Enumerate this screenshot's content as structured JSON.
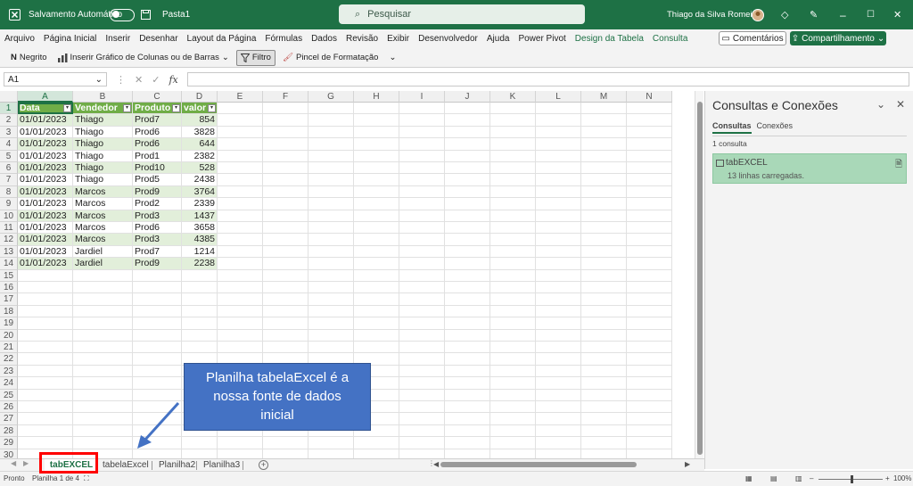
{
  "titlebar": {
    "autosave_label": "Salvamento Automático",
    "doc_name": "Pasta1",
    "search_placeholder": "Pesquisar",
    "user_name": "Thiago da Silva Romeiro",
    "accent_color": "#1e7145"
  },
  "menu": {
    "items": [
      "Arquivo",
      "Página Inicial",
      "Inserir",
      "Desenhar",
      "Layout da Página",
      "Fórmulas",
      "Dados",
      "Revisão",
      "Exibir",
      "Desenvolvedor",
      "Ajuda",
      "Power Pivot",
      "Design da Tabela",
      "Consulta"
    ],
    "comments_label": "Comentários",
    "share_label": "Compartilhamento"
  },
  "ribbon": {
    "bold_label": "Negrito",
    "chart_label": "Inserir Gráfico de Colunas ou de Barras",
    "filter_label": "Filtro",
    "format_painter_label": "Pincel de Formatação"
  },
  "formula_bar": {
    "name_box": "A1",
    "fx_label": "fx"
  },
  "sheet": {
    "columns": [
      "A",
      "B",
      "C",
      "D",
      "E",
      "F",
      "G",
      "H",
      "I",
      "J",
      "K",
      "L",
      "M",
      "N"
    ],
    "row_numbers": [
      "1",
      "2",
      "3",
      "4",
      "5",
      "6",
      "7",
      "8",
      "9",
      "10",
      "11",
      "12",
      "13",
      "14",
      "15",
      "16",
      "17",
      "18",
      "19",
      "20",
      "21",
      "22",
      "23",
      "24",
      "25",
      "26",
      "27",
      "28",
      "29",
      "30"
    ],
    "table_headers": [
      "Data",
      "Vendedor",
      "Produto",
      "valor"
    ],
    "table_rows": [
      [
        "01/01/2023",
        "Thiago",
        "Prod7",
        "854"
      ],
      [
        "01/01/2023",
        "Thiago",
        "Prod6",
        "3828"
      ],
      [
        "01/01/2023",
        "Thiago",
        "Prod6",
        "644"
      ],
      [
        "01/01/2023",
        "Thiago",
        "Prod1",
        "2382"
      ],
      [
        "01/01/2023",
        "Thiago",
        "Prod10",
        "528"
      ],
      [
        "01/01/2023",
        "Thiago",
        "Prod5",
        "2438"
      ],
      [
        "01/01/2023",
        "Marcos",
        "Prod9",
        "3764"
      ],
      [
        "01/01/2023",
        "Marcos",
        "Prod2",
        "2339"
      ],
      [
        "01/01/2023",
        "Marcos",
        "Prod3",
        "1437"
      ],
      [
        "01/01/2023",
        "Marcos",
        "Prod6",
        "3658"
      ],
      [
        "01/01/2023",
        "Marcos",
        "Prod3",
        "4385"
      ],
      [
        "01/01/2023",
        "Jardiel",
        "Prod7",
        "1214"
      ],
      [
        "01/01/2023",
        "Jardiel",
        "Prod9",
        "2238"
      ]
    ],
    "header_color": "#70ad47",
    "band_color": "#e2efda"
  },
  "pane": {
    "title": "Consultas e Conexões",
    "tab_queries": "Consultas",
    "tab_connections": "Conexões",
    "count_label": "1 consulta",
    "query_name": "tabEXCEL",
    "query_rows": "13 linhas carregadas."
  },
  "sheet_tabs": [
    "tabEXCEL",
    "tabelaExcel",
    "Planilha2",
    "Planilha3"
  ],
  "status": {
    "ready": "Pronto",
    "sheet_index": "Planilha 1 de 4",
    "zoom": "100%"
  },
  "annotation": {
    "callout_lines": [
      "Planilha tabelaExcel é a",
      "nossa fonte de dados",
      "inicial"
    ]
  }
}
